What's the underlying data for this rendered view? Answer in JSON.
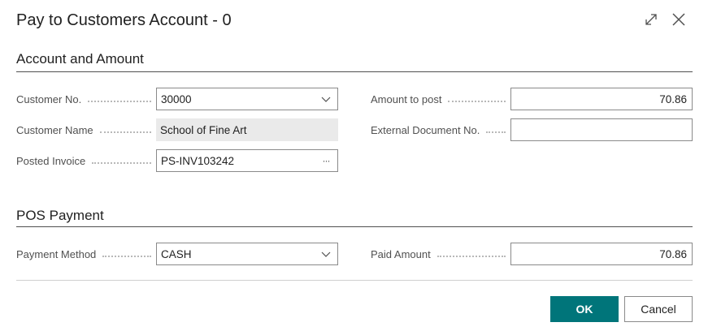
{
  "dialog": {
    "title": "Pay to Customers Account - 0"
  },
  "icons": {
    "expand": "expand-icon",
    "close": "close-icon",
    "dropdown": "chevron-down-icon",
    "lookup": "ellipsis-icon"
  },
  "account_section": {
    "title": "Account and Amount",
    "customer_no": {
      "label": "Customer No.",
      "value": "30000"
    },
    "customer_name": {
      "label": "Customer Name",
      "value": "School of Fine Art"
    },
    "posted_invoice": {
      "label": "Posted Invoice",
      "value": "PS-INV103242",
      "lookup_glyph": "···"
    },
    "amount_to_post": {
      "label": "Amount to post",
      "value": "70.86"
    },
    "external_doc_no": {
      "label": "External Document No.",
      "value": ""
    }
  },
  "pos_section": {
    "title": "POS Payment",
    "payment_method": {
      "label": "Payment Method",
      "value": "CASH"
    },
    "paid_amount": {
      "label": "Paid Amount",
      "value": "70.86"
    }
  },
  "buttons": {
    "ok": "OK",
    "cancel": "Cancel"
  },
  "colors": {
    "accent": "#00757a",
    "readonly_bg": "#eaeaea"
  }
}
